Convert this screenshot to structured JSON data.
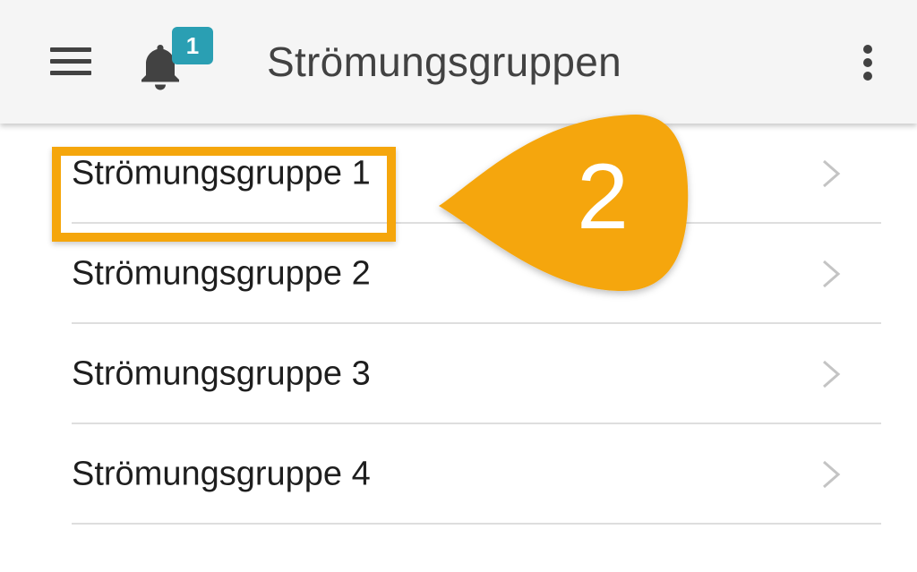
{
  "appbar": {
    "title": "Strömungsgruppen",
    "menu_icon": "hamburger-menu-icon",
    "notification_icon": "bell-icon",
    "notification_count": "1",
    "overflow_icon": "more-vert-icon"
  },
  "list": {
    "items": [
      {
        "label": "Strömungsgruppe 1"
      },
      {
        "label": "Strömungsgruppe 2"
      },
      {
        "label": "Strömungsgruppe 3"
      },
      {
        "label": "Strömungsgruppe 4"
      }
    ],
    "chevron_icon": "chevron-right-icon"
  },
  "annotation": {
    "step": "2",
    "color": "#f5a60c",
    "target": "Strömungsgruppe 1"
  },
  "colors": {
    "appbar_bg": "#f5f5f5",
    "badge": "#2a9fb3",
    "text": "#424242",
    "accent": "#f5a60c"
  }
}
